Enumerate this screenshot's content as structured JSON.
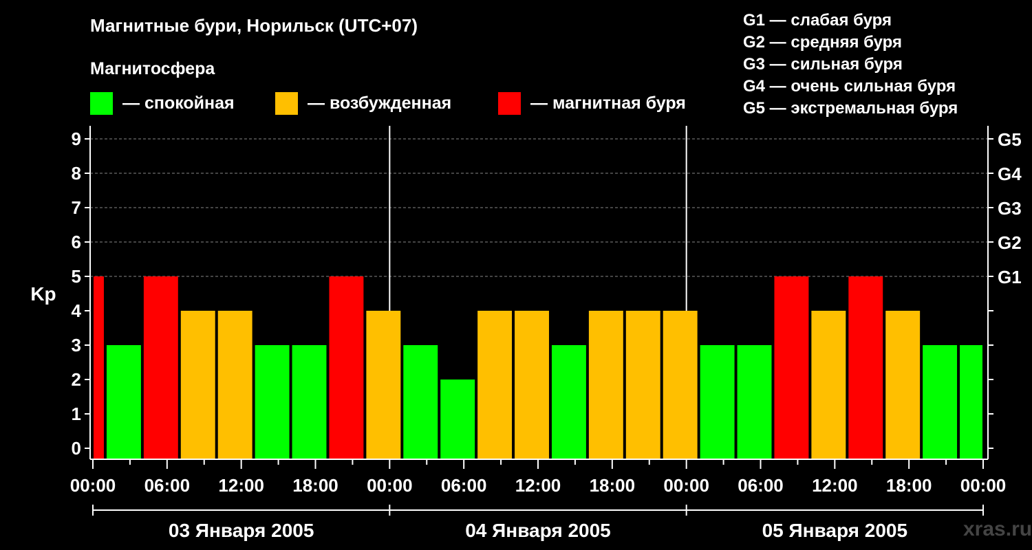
{
  "header": {
    "title": "Магнитные бури, Норильск (UTC+07)",
    "subtitle": "Магнитосфера"
  },
  "legend": {
    "items": [
      {
        "label": "— спокойная",
        "color": "#00ff00"
      },
      {
        "label": "— возбужденная",
        "color": "#ffbf00"
      },
      {
        "label": "— магнитная буря",
        "color": "#ff0000"
      }
    ],
    "g_levels": [
      "G1 — слабая буря",
      "G2 — средняя буря",
      "G3 — сильная буря",
      "G4 — очень сильная буря",
      "G5 — экстремальная буря"
    ]
  },
  "watermark": "xras.ru",
  "chart_data": {
    "type": "bar",
    "ylabel": "Kp",
    "ylim": [
      0,
      9
    ],
    "yticks": [
      0,
      1,
      2,
      3,
      4,
      5,
      6,
      7,
      8,
      9
    ],
    "right_axis_labels": [
      {
        "kp": 5,
        "label": "G1"
      },
      {
        "kp": 6,
        "label": "G2"
      },
      {
        "kp": 7,
        "label": "G3"
      },
      {
        "kp": 8,
        "label": "G4"
      },
      {
        "kp": 9,
        "label": "G5"
      }
    ],
    "xticks": [
      "00:00",
      "06:00",
      "12:00",
      "18:00",
      "00:00",
      "06:00",
      "12:00",
      "18:00",
      "00:00",
      "06:00",
      "12:00",
      "18:00",
      "00:00"
    ],
    "days": [
      "03 Января 2005",
      "04 Января 2005",
      "05 Января 2005"
    ],
    "x_hours_range": [
      0,
      72
    ],
    "colors": {
      "calm": "#00ff00",
      "disturbed": "#ffbf00",
      "storm": "#ff0000"
    },
    "bars": [
      {
        "start_h": 0,
        "end_h": 1,
        "kp": 5
      },
      {
        "start_h": 1,
        "end_h": 4,
        "kp": 3
      },
      {
        "start_h": 4,
        "end_h": 7,
        "kp": 5
      },
      {
        "start_h": 7,
        "end_h": 10,
        "kp": 4
      },
      {
        "start_h": 10,
        "end_h": 13,
        "kp": 4
      },
      {
        "start_h": 13,
        "end_h": 16,
        "kp": 3
      },
      {
        "start_h": 16,
        "end_h": 19,
        "kp": 3
      },
      {
        "start_h": 19,
        "end_h": 22,
        "kp": 5
      },
      {
        "start_h": 22,
        "end_h": 25,
        "kp": 4
      },
      {
        "start_h": 25,
        "end_h": 28,
        "kp": 3
      },
      {
        "start_h": 28,
        "end_h": 31,
        "kp": 2
      },
      {
        "start_h": 31,
        "end_h": 34,
        "kp": 4
      },
      {
        "start_h": 34,
        "end_h": 37,
        "kp": 4
      },
      {
        "start_h": 37,
        "end_h": 40,
        "kp": 3
      },
      {
        "start_h": 40,
        "end_h": 43,
        "kp": 4
      },
      {
        "start_h": 43,
        "end_h": 46,
        "kp": 4
      },
      {
        "start_h": 46,
        "end_h": 49,
        "kp": 4
      },
      {
        "start_h": 49,
        "end_h": 52,
        "kp": 3
      },
      {
        "start_h": 52,
        "end_h": 55,
        "kp": 3
      },
      {
        "start_h": 55,
        "end_h": 58,
        "kp": 5
      },
      {
        "start_h": 58,
        "end_h": 61,
        "kp": 4
      },
      {
        "start_h": 61,
        "end_h": 64,
        "kp": 5
      },
      {
        "start_h": 64,
        "end_h": 67,
        "kp": 4
      },
      {
        "start_h": 67,
        "end_h": 70,
        "kp": 3
      },
      {
        "start_h": 70,
        "end_h": 72,
        "kp": 3
      }
    ]
  }
}
